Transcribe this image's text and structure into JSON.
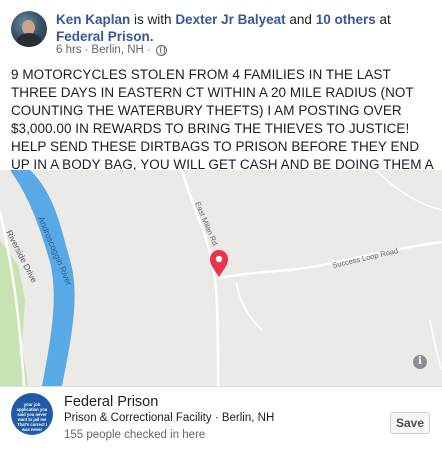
{
  "post": {
    "author": "Ken Kaplan",
    "with_text": "is with",
    "tagged_person": "Dexter Jr Balyeat",
    "and_text": "and",
    "others": "10 others",
    "at_text": "at",
    "location": "Federal Prison.",
    "time": "6 hrs",
    "separator": "·",
    "place": "Berlin, NH",
    "separator2": "·",
    "privacy_icon": "globe-icon",
    "body": "9 MOTORCYCLES STOLEN FROM 4 FAMILIES IN THE LAST THREE DAYS IN EASTERN CT WITHIN A 20 MILE RADIUS (NOT COUNTING THE WATERBURY THEFTS) I AM POSTING OVER $3,000.00 IN REWARDS TO BRING THE THIEVES TO JUSTICE! HELP SEND THESE DIRTBAGS TO PRISON BEFORE THEY END UP IN A BODY BAG, YOU WILL GET CASH AND BE DOING THEM A FAVOR"
  },
  "map": {
    "labels": {
      "river_name": "Androscoggin River",
      "drive": "Riverside Drive",
      "east_milan": "East Milan Rd",
      "success_loop": "Success Loop Road"
    },
    "info_label": "i",
    "colors": {
      "water": "#58a9e6",
      "park": "#c8e2b3",
      "road": "#ffffff",
      "pin": "#e8344e",
      "land": "#ebeae6"
    }
  },
  "place_card": {
    "name": "Federal Prison",
    "category": "Prison & Correctional Facility · Berlin, NH",
    "checkins": "155 people checked in here",
    "save_label": "Save",
    "thumb_text": "your job application you said you never want to jail me That's correct I was never"
  }
}
